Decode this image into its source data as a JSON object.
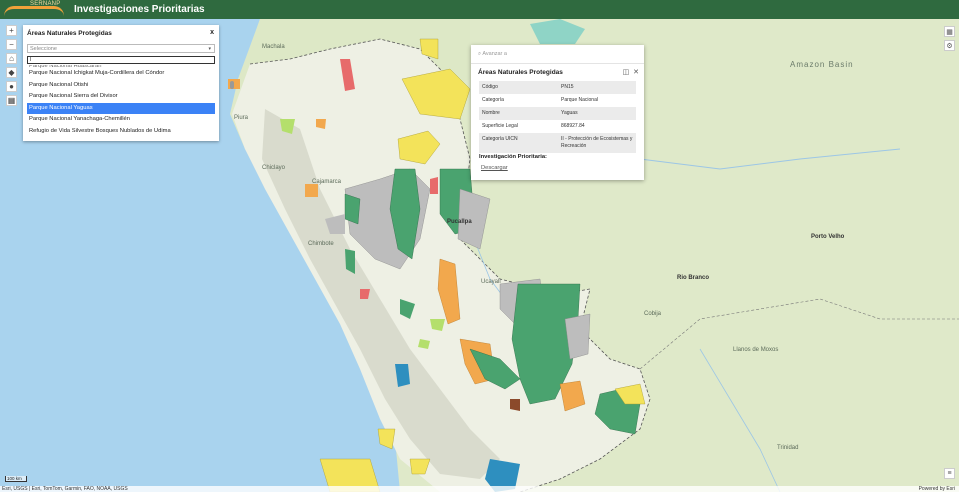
{
  "header": {
    "logo_text": "SERNANP",
    "title": "Investigaciones Prioritarias"
  },
  "colors": {
    "header_bg": "#2f6a3f",
    "parque_nacional": "#4aa36f",
    "reserva_nacional": "#f2a84d",
    "zona_reservada": "#bdbdbd",
    "santuario": "#e76b6b",
    "reserva_comunal": "#f3e35a",
    "bosque_proteccion": "#b4df6c",
    "acr": "#2e8fbf",
    "selected": "#3b82f6"
  },
  "left_tools": [
    "zoom-in",
    "zoom-out",
    "home",
    "compass",
    "locate",
    "basemap"
  ],
  "panel": {
    "title": "Áreas Naturales Protegidas",
    "close": "x",
    "select_placeholder": "Seleccione",
    "filter_value": "l",
    "items": [
      "Parque Nacional Huascarán",
      "Parque Nacional Ichigkat Muja-Cordillera del Cóndor",
      "Parque Nacional Otishi",
      "Parque Nacional Sierra del Divisor",
      "Parque Nacional Yaguas",
      "Parque Nacional Yanachaga-Chemillén",
      "Refugio de Vida Silvestre Bosques Nublados de Udima"
    ],
    "selected_index": 4
  },
  "popup": {
    "advance": "Avanzar a",
    "title": "Áreas Naturales Protegidas",
    "rows": [
      {
        "key": "Código",
        "value": "PN15"
      },
      {
        "key": "Categoría",
        "value": "Parque Nacional"
      },
      {
        "key": "Nombre",
        "value": "Yaguas"
      },
      {
        "key": "Superficie Legal",
        "value": "868927.84"
      },
      {
        "key": "Categoría UICN",
        "value": "II - Protección de Ecosistemas y Recreación"
      }
    ],
    "research_label": "Investigación Prioritaria:",
    "download": "Descargar"
  },
  "map_labels": {
    "amazon_basin": "Amazon Basin",
    "pucallpa": "Pucallpa",
    "rio_branco": "Rio Branco",
    "porto_velho": "Porto Velho",
    "chiclayo": "Chiclayo",
    "chimbote": "Chimbote",
    "cobija": "Cobija",
    "trinidad": "Trinidad",
    "ucayali": "Ucayali",
    "machala": "Machala",
    "piura": "Piura",
    "cajamarca": "Cajamarca",
    "llanos_de_moxos": "Llanos de Moxos"
  },
  "scale": "100 km",
  "attribution": "Esri, USGS | Esri, TomTom, Garmin, FAO, NOAA, USGS",
  "powered_by": "Powered by Esri"
}
